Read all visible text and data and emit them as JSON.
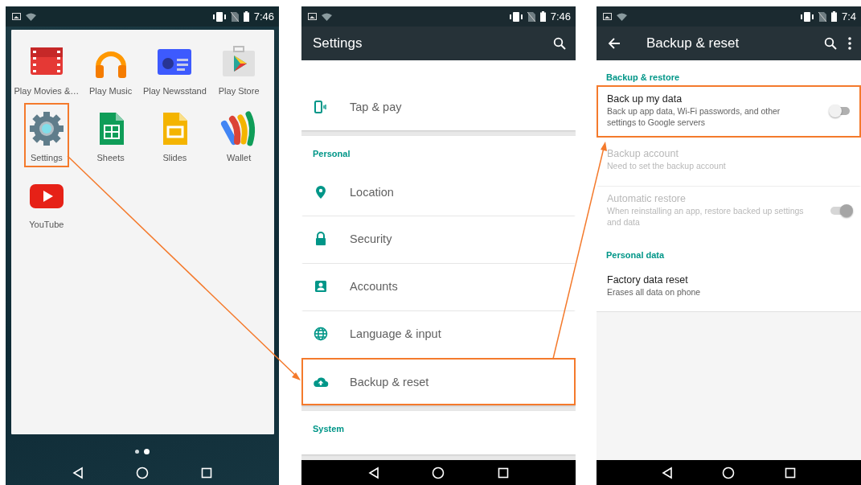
{
  "phones": [
    {
      "kind": "launcher",
      "status": {
        "time": "7:46"
      },
      "apps": [
        {
          "label": "Play Movies &…",
          "highlighted": false
        },
        {
          "label": "Play Music",
          "highlighted": false
        },
        {
          "label": "Play Newsstand",
          "highlighted": false
        },
        {
          "label": "Play Store",
          "highlighted": false
        },
        {
          "label": "Settings",
          "highlighted": true
        },
        {
          "label": "Sheets",
          "highlighted": false
        },
        {
          "label": "Slides",
          "highlighted": false
        },
        {
          "label": "Wallet",
          "highlighted": false
        },
        {
          "label": "YouTube",
          "highlighted": false
        }
      ],
      "page_dots": [
        {
          "selected": false
        },
        {
          "selected": true
        }
      ]
    },
    {
      "kind": "settings",
      "status": {
        "time": "7:46"
      },
      "app_bar": {
        "title": "Settings"
      },
      "sections": [
        {
          "items": [
            {
              "label": "Tap & pay",
              "highlighted": false
            }
          ]
        },
        {
          "header": "Personal",
          "items": [
            {
              "label": "Location",
              "highlighted": false
            },
            {
              "label": "Security",
              "highlighted": false
            },
            {
              "label": "Accounts",
              "highlighted": false
            },
            {
              "label": "Language & input",
              "highlighted": false
            },
            {
              "label": "Backup & reset",
              "highlighted": true
            }
          ]
        },
        {
          "header": "System"
        }
      ]
    },
    {
      "kind": "detail",
      "status": {
        "time": "7:4"
      },
      "app_bar": {
        "title": "Backup & reset"
      },
      "sections": [
        {
          "header": "Backup & restore",
          "items": [
            {
              "title": "Back up my data",
              "summary": "Back up app data, Wi-Fi passwords, and other settings to Google servers",
              "disabled": false,
              "highlighted": true,
              "switch_on": false
            },
            {
              "title": "Backup account",
              "summary": "Need to set the backup account",
              "disabled": true,
              "highlighted": false
            },
            {
              "title": "Automatic restore",
              "summary": "When reinstalling an app, restore backed up settings and data",
              "disabled": true,
              "highlighted": false,
              "switch_on": true
            }
          ]
        },
        {
          "header": "Personal data",
          "items": [
            {
              "title": "Factory data reset",
              "summary": "Erases all data on phone",
              "disabled": false,
              "highlighted": false
            }
          ]
        }
      ]
    }
  ]
}
